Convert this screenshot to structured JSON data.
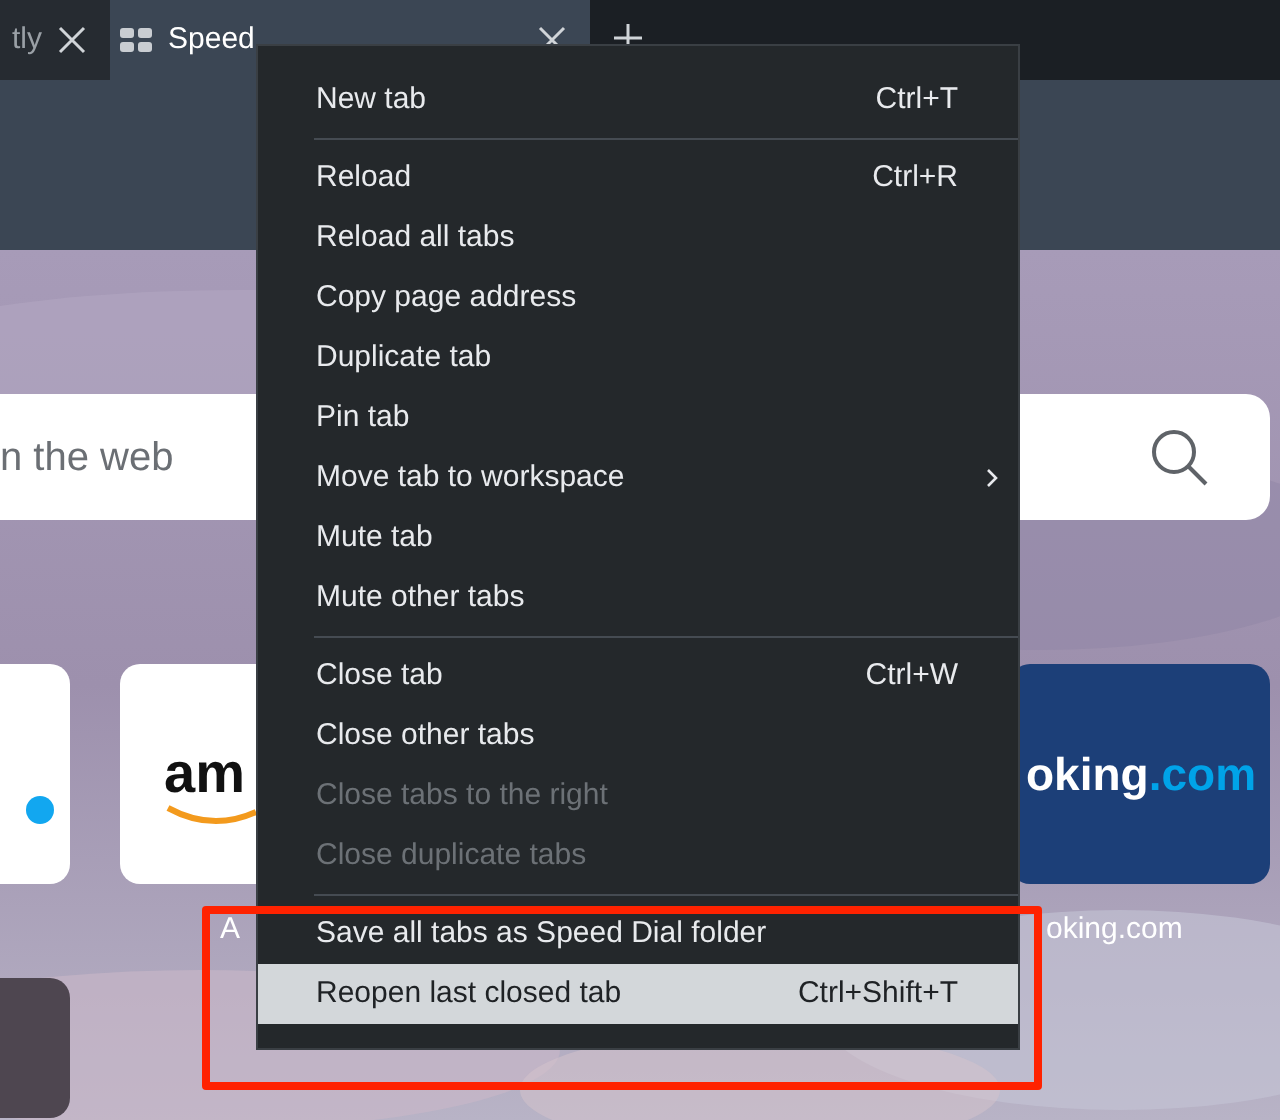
{
  "tabs": [
    {
      "title": "tly",
      "selected": false,
      "icon": false
    },
    {
      "title": "Speed",
      "selected": true,
      "icon": true
    }
  ],
  "search": {
    "placeholder": "n the web"
  },
  "tiles": [
    {
      "kind": "white"
    },
    {
      "kind": "white",
      "logo": "am",
      "caption": "A"
    },
    {
      "kind": "blue",
      "logo": "oking",
      "logo_accent": ".com",
      "caption": "oking.com"
    }
  ],
  "menu": {
    "sections": [
      [
        {
          "label": "New tab",
          "shortcut": "Ctrl+T",
          "disabled": false,
          "highlighted": false,
          "submenu": false
        }
      ],
      [
        {
          "label": "Reload",
          "shortcut": "Ctrl+R",
          "disabled": false,
          "highlighted": false,
          "submenu": false
        },
        {
          "label": "Reload all tabs",
          "disabled": false,
          "highlighted": false,
          "submenu": false
        },
        {
          "label": "Copy page address",
          "disabled": false,
          "highlighted": false,
          "submenu": false
        },
        {
          "label": "Duplicate tab",
          "disabled": false,
          "highlighted": false,
          "submenu": false
        },
        {
          "label": "Pin tab",
          "disabled": false,
          "highlighted": false,
          "submenu": false
        },
        {
          "label": "Move tab to workspace",
          "disabled": false,
          "highlighted": false,
          "submenu": true
        },
        {
          "label": "Mute tab",
          "disabled": false,
          "highlighted": false,
          "submenu": false
        },
        {
          "label": "Mute other tabs",
          "disabled": false,
          "highlighted": false,
          "submenu": false
        }
      ],
      [
        {
          "label": "Close tab",
          "shortcut": "Ctrl+W",
          "disabled": false,
          "highlighted": false,
          "submenu": false
        },
        {
          "label": "Close other tabs",
          "disabled": false,
          "highlighted": false,
          "submenu": false
        },
        {
          "label": "Close tabs to the right",
          "disabled": true,
          "highlighted": false,
          "submenu": false
        },
        {
          "label": "Close duplicate tabs",
          "disabled": true,
          "highlighted": false,
          "submenu": false
        }
      ],
      [
        {
          "label": "Save all tabs as Speed Dial folder",
          "disabled": false,
          "highlighted": false,
          "submenu": false
        },
        {
          "label": "Reopen last closed tab",
          "shortcut": "Ctrl+Shift+T",
          "disabled": false,
          "highlighted": true,
          "submenu": false
        }
      ]
    ]
  },
  "annotation": {
    "kind": "highlight-box"
  }
}
